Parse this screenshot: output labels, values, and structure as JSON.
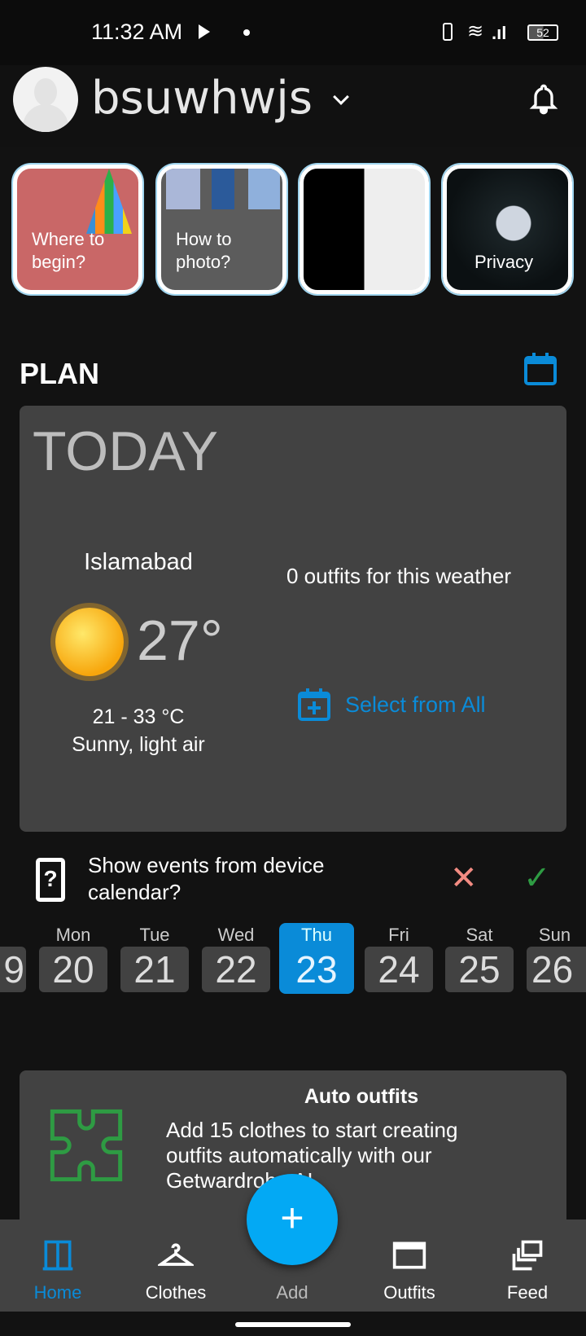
{
  "status_bar": {
    "time": "11:32 AM",
    "battery": "52"
  },
  "header": {
    "username": "bsuwhwjs"
  },
  "stories": [
    {
      "label": "Where to begin?"
    },
    {
      "label": "How to photo?"
    },
    {
      "label": ""
    },
    {
      "label": "Privacy"
    }
  ],
  "plan": {
    "title": "PLAN",
    "today_label": "TODAY",
    "city": "Islamabad",
    "temperature": "27°",
    "range": "21 - 33 °C",
    "condition": "Sunny, light air",
    "outfits_count_text": "0 outfits for this weather",
    "select_all": "Select from All"
  },
  "calendar_prompt": {
    "text": "Show events from device calendar?"
  },
  "week": [
    {
      "day": "",
      "num": "9"
    },
    {
      "day": "Mon",
      "num": "20"
    },
    {
      "day": "Tue",
      "num": "21"
    },
    {
      "day": "Wed",
      "num": "22"
    },
    {
      "day": "Thu",
      "num": "23",
      "selected": true
    },
    {
      "day": "Fri",
      "num": "24"
    },
    {
      "day": "Sat",
      "num": "25"
    },
    {
      "day": "Sun",
      "num": "26"
    }
  ],
  "auto_outfits": {
    "title": "Auto outfits",
    "text": "Add 15 clothes to start creating outfits automatically with our Getwardrobe AI"
  },
  "nav": {
    "items": [
      {
        "label": "Home",
        "active": true
      },
      {
        "label": "Clothes"
      },
      {
        "label": "Add"
      },
      {
        "label": "Outfits"
      },
      {
        "label": "Feed"
      }
    ]
  },
  "colors": {
    "accent": "#0a8bd8",
    "fab": "#03a9f4",
    "decline": "#f28b82",
    "accept": "#2e9b43"
  }
}
